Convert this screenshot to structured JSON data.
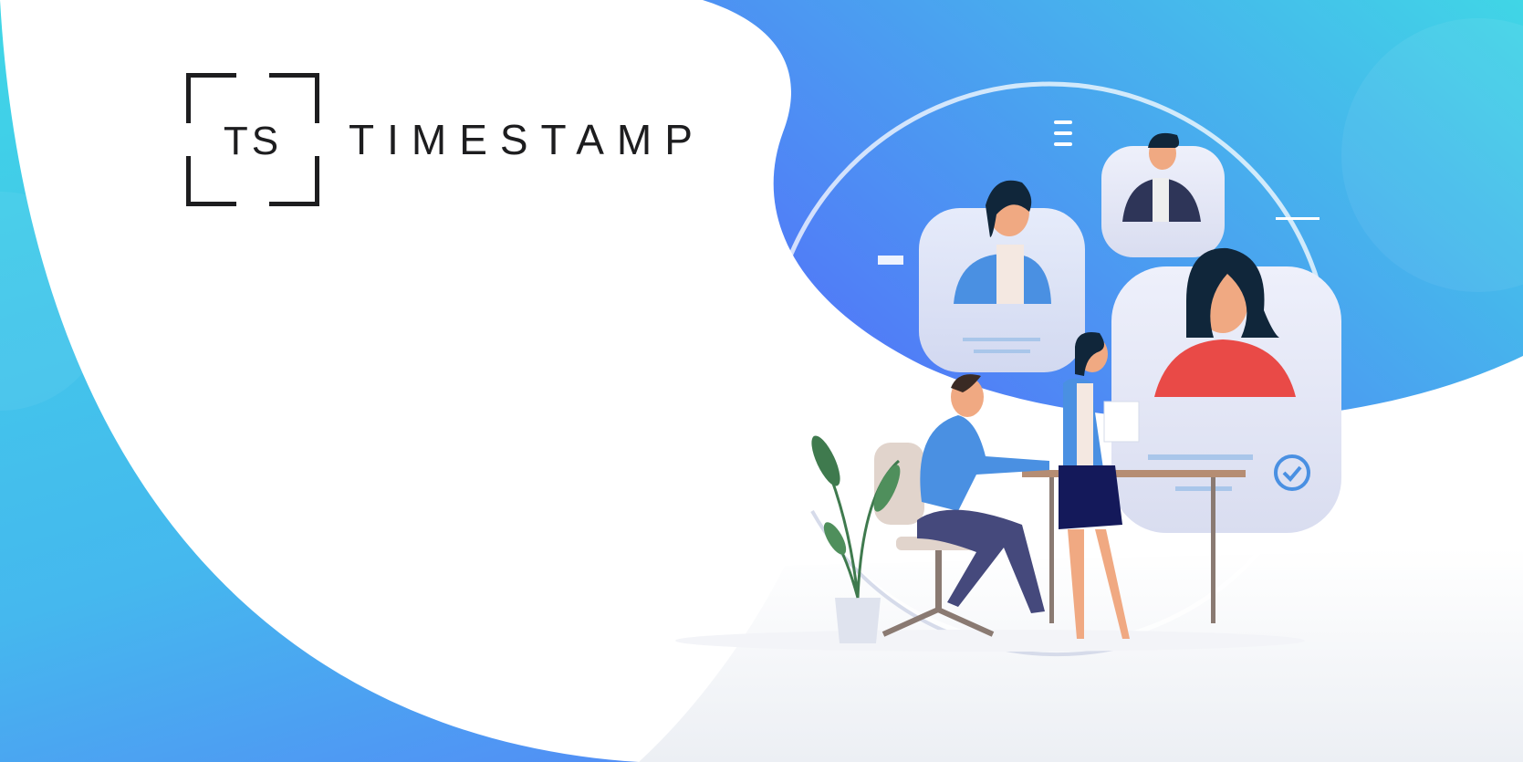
{
  "brand": {
    "mark_text": "TS",
    "name": "TIMESTAMP"
  },
  "colors": {
    "cyan": "#3fd6e6",
    "blue": "#5277f8",
    "ink": "#1d1d1f",
    "red": "#e94a47"
  }
}
